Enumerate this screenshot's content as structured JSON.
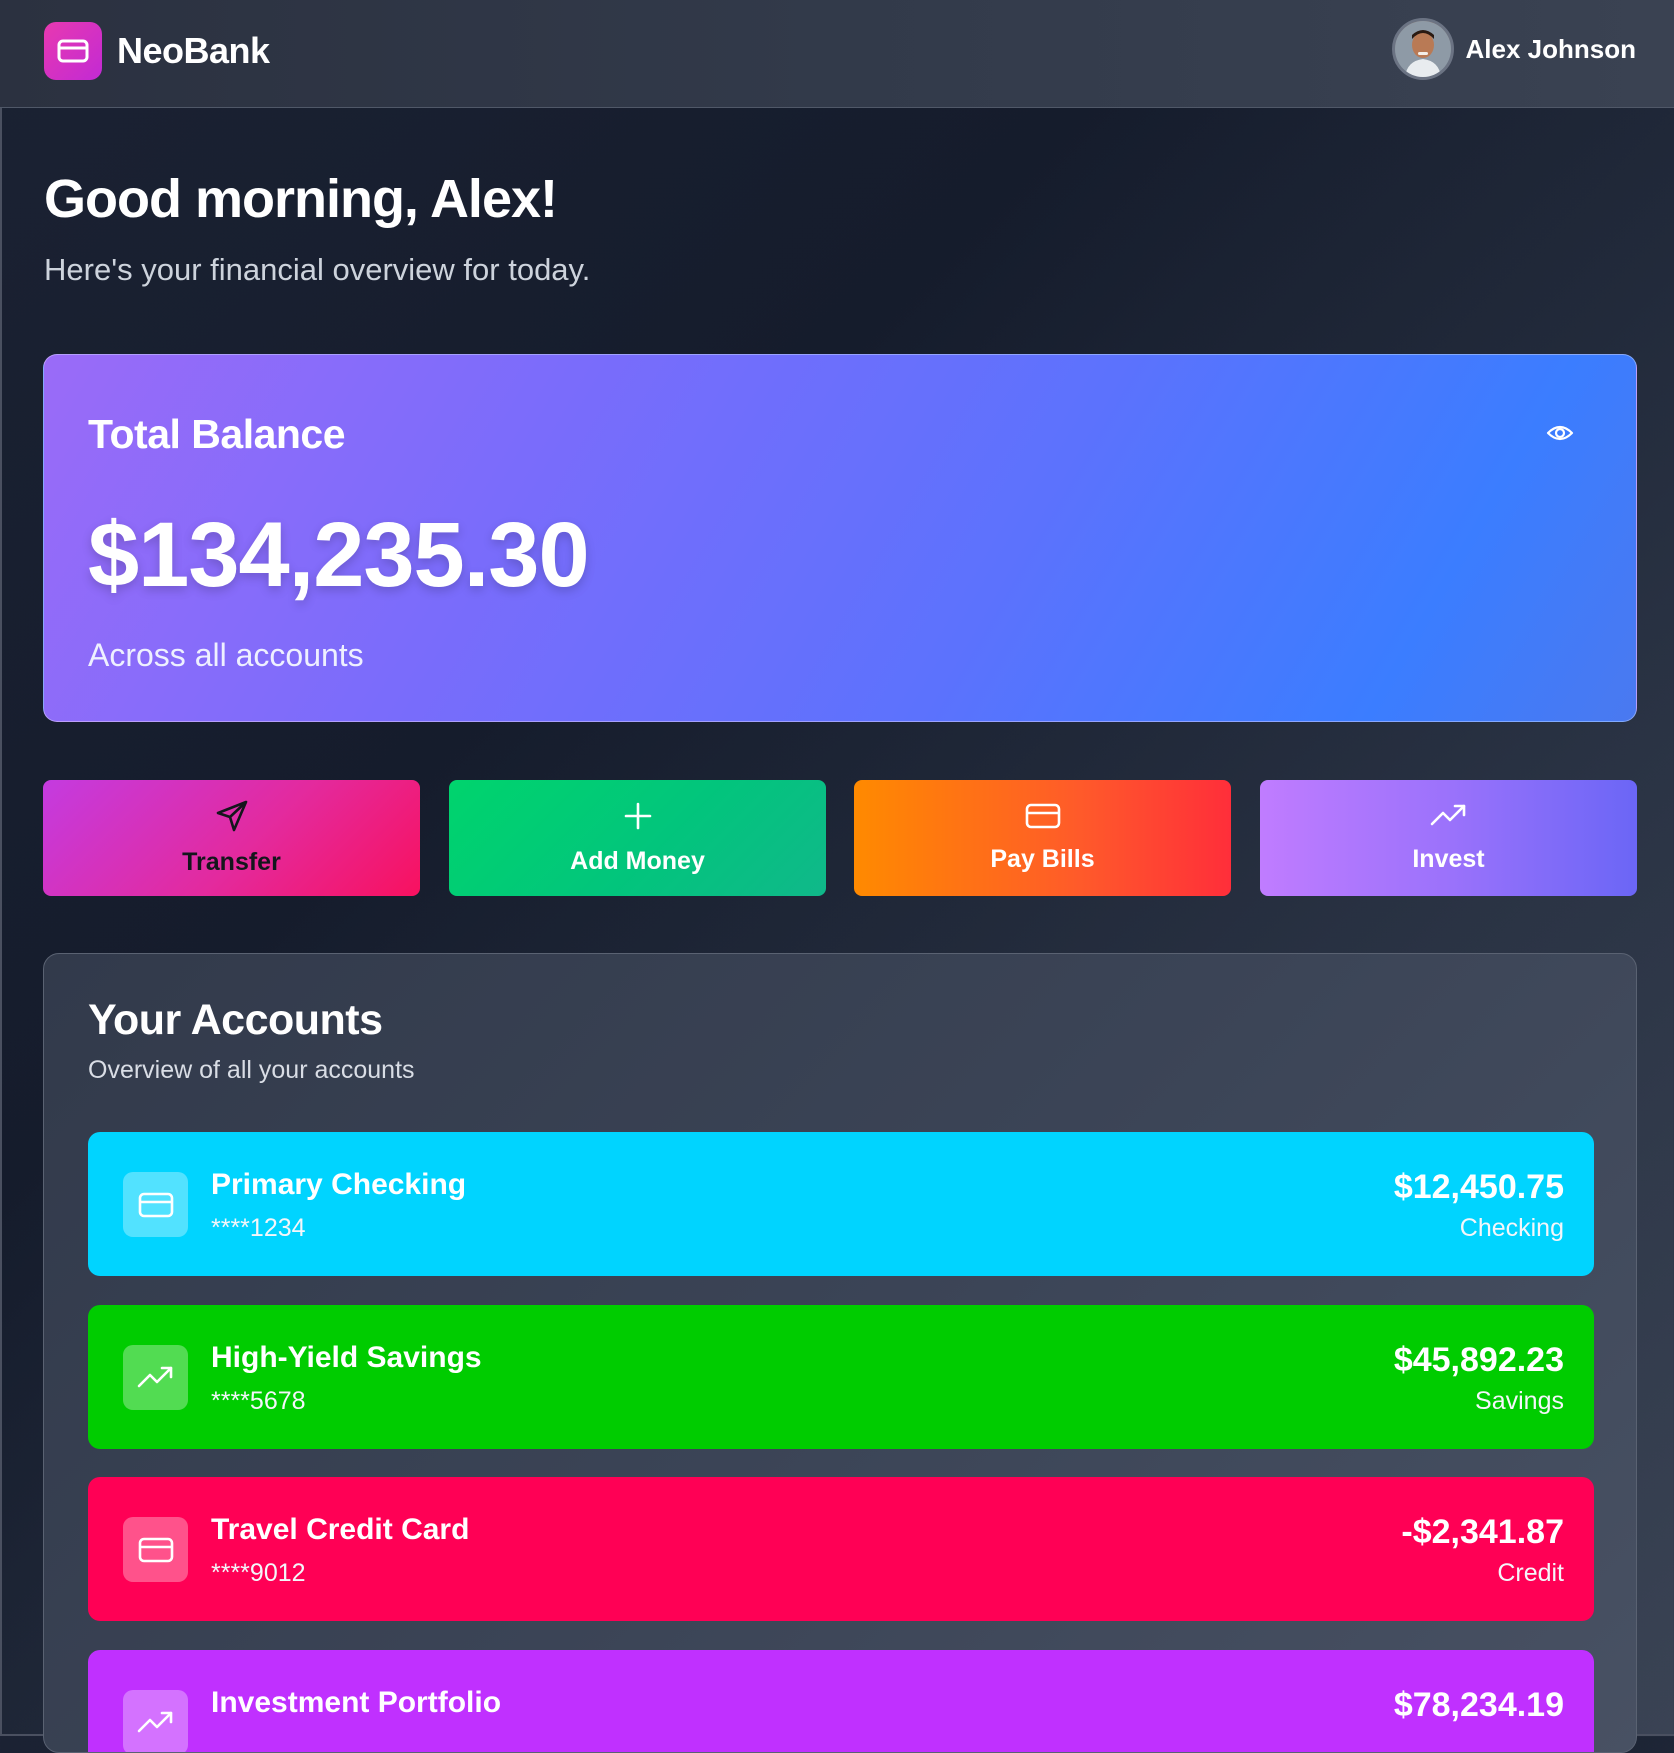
{
  "header": {
    "brand_name": "NeoBank",
    "user_name": "Alex Johnson"
  },
  "greeting": {
    "title": "Good morning, Alex!",
    "subtitle": "Here's your financial overview for today."
  },
  "balance": {
    "title": "Total Balance",
    "amount": "$134,235.30",
    "caption": "Across all accounts"
  },
  "actions": [
    {
      "label": "Transfer",
      "icon": "send-icon"
    },
    {
      "label": "Add Money",
      "icon": "plus-icon"
    },
    {
      "label": "Pay Bills",
      "icon": "credit-card-icon"
    },
    {
      "label": "Invest",
      "icon": "trending-up-icon"
    }
  ],
  "accounts_section": {
    "title": "Your Accounts",
    "subtitle": "Overview of all your accounts",
    "items": [
      {
        "name": "Primary Checking",
        "number": "****1234",
        "balance": "$12,450.75",
        "type": "Checking",
        "icon": "credit-card-icon",
        "color": "#00d4ff"
      },
      {
        "name": "High-Yield Savings",
        "number": "****5678",
        "balance": "$45,892.23",
        "type": "Savings",
        "icon": "trending-up-icon",
        "color": "#00cc00"
      },
      {
        "name": "Travel Credit Card",
        "number": "****9012",
        "balance": "-$2,341.87",
        "type": "Credit",
        "icon": "credit-card-icon",
        "color": "#ff0055"
      },
      {
        "name": "Investment Portfolio",
        "number": "",
        "balance": "$78,234.19",
        "type": "",
        "icon": "trending-up-icon",
        "color": "#c030ff"
      }
    ]
  },
  "colors": {
    "brand_accent": "#e839b0",
    "balance_card_start": "#9a6bf8",
    "balance_card_end": "#3b7dff"
  }
}
